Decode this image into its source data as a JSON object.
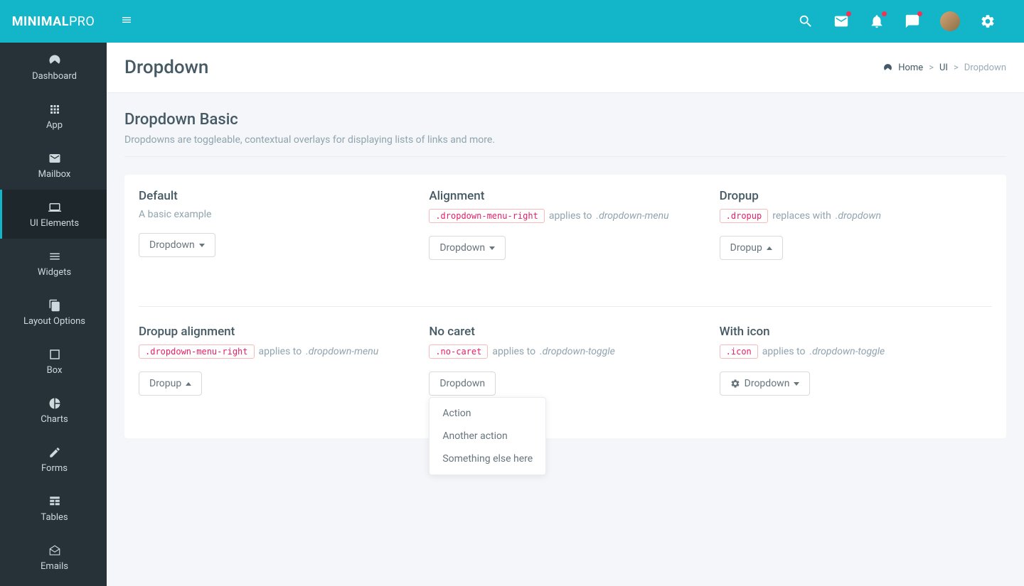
{
  "brand": {
    "part1": "MINIMAL",
    "part2": "PRO"
  },
  "sidebar": {
    "items": [
      {
        "label": "Dashboard"
      },
      {
        "label": "App"
      },
      {
        "label": "Mailbox"
      },
      {
        "label": "UI Elements"
      },
      {
        "label": "Widgets"
      },
      {
        "label": "Layout Options"
      },
      {
        "label": "Box"
      },
      {
        "label": "Charts"
      },
      {
        "label": "Forms"
      },
      {
        "label": "Tables"
      },
      {
        "label": "Emails"
      }
    ]
  },
  "page": {
    "title": "Dropdown",
    "breadcrumb": {
      "home": "Home",
      "parent": "UI",
      "current": "Dropdown"
    }
  },
  "section": {
    "title": "Dropdown Basic",
    "desc": "Dropdowns are toggleable, contextual overlays for displaying lists of links and more."
  },
  "examples": {
    "default": {
      "title": "Default",
      "desc": "A basic example",
      "button": "Dropdown"
    },
    "alignment": {
      "title": "Alignment",
      "code": ".dropdown-menu-right",
      "desc_prefix": "applies to",
      "desc_em": ".dropdown-menu",
      "button": "Dropdown"
    },
    "dropup": {
      "title": "Dropup",
      "code": ".dropup",
      "desc_prefix": "replaces with",
      "desc_em": ".dropdown",
      "button": "Dropup"
    },
    "dropup_align": {
      "title": "Dropup alignment",
      "code": ".dropdown-menu-right",
      "desc_prefix": "applies to",
      "desc_em": ".dropdown-menu",
      "button": "Dropup"
    },
    "no_caret": {
      "title": "No caret",
      "code": ".no-caret",
      "desc_prefix": "applies to",
      "desc_em": ".dropdown-toggle",
      "button": "Dropdown",
      "menu": [
        "Action",
        "Another action",
        "Something else here"
      ]
    },
    "with_icon": {
      "title": "With icon",
      "code": ".icon",
      "desc_prefix": "applies to",
      "desc_em": ".dropdown-toggle",
      "button": "Dropdown"
    }
  }
}
